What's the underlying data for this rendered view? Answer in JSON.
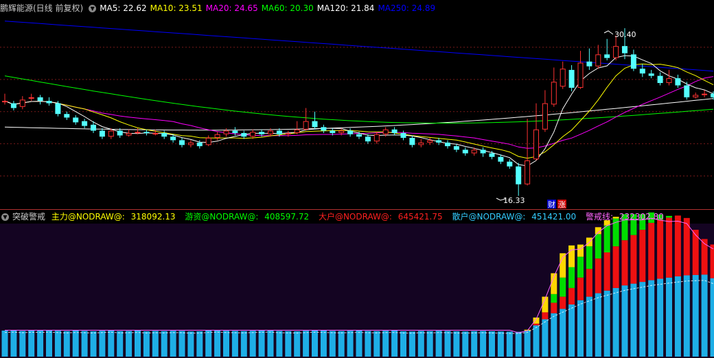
{
  "main_header": {
    "title": "鹏辉能源(日线 前复权)",
    "items": [
      {
        "label": "MA5: 22.62",
        "color": "#ffffff"
      },
      {
        "label": "MA10: 23.51",
        "color": "#ffff00"
      },
      {
        "label": "MA20: 24.65",
        "color": "#ff00ff"
      },
      {
        "label": "MA60: 20.30",
        "color": "#00ff00"
      },
      {
        "label": "MA120: 21.84",
        "color": "#ffffff"
      },
      {
        "label": "MA250: 24.89",
        "color": "#0000ff"
      }
    ]
  },
  "sub_header": {
    "title": "突破警戒",
    "items": [
      {
        "label": "主力@NODRAW@:",
        "value": "318092.13",
        "color": "#ffff00"
      },
      {
        "label": "游资@NODRAW@:",
        "value": "408597.72",
        "color": "#00ff00"
      },
      {
        "label": "大户@NODRAW@:",
        "value": "645421.75",
        "color": "#ff2020"
      },
      {
        "label": "散户@NODRAW@:",
        "value": "451421.00",
        "color": "#33ccff"
      },
      {
        "label": "警戒线:",
        "value": "232302.80",
        "color": "#ff66ff"
      }
    ]
  },
  "annotations": {
    "high_label": "30.40",
    "low_label": "16.33",
    "marker_cai": "财",
    "marker_zhang": "涨"
  },
  "colors": {
    "up": "#ff3232",
    "down": "#54ffff",
    "ma5": "#ffffff",
    "ma10": "#ffff00",
    "ma20": "#ff00ff",
    "ma60": "#00ff00",
    "ma120": "#ffffff",
    "ma250": "#0000ff",
    "zhuli": "#ffd700",
    "youzi": "#00dd00",
    "dahu": "#ee1111",
    "sanhu": "#1eaee6",
    "alert": "#ff66ff",
    "grid": "#7a1a1a",
    "sub_bg": "#140422"
  },
  "chart_data": [
    {
      "type": "candlestick",
      "title": "鹏辉能源(日线 前复权)",
      "price_range": [
        15.5,
        31.5
      ],
      "candles": [
        [
          24.2,
          24.3,
          24.9,
          24.0
        ],
        [
          24.1,
          23.7,
          24.3,
          23.5
        ],
        [
          23.8,
          24.4,
          24.7,
          23.6
        ],
        [
          24.5,
          24.6,
          24.9,
          24.3
        ],
        [
          24.6,
          24.3,
          24.8,
          24.0
        ],
        [
          24.3,
          24.1,
          24.6,
          23.9
        ],
        [
          24.1,
          23.2,
          24.3,
          23.0
        ],
        [
          23.2,
          22.9,
          23.4,
          22.7
        ],
        [
          22.9,
          22.5,
          23.1,
          22.3
        ],
        [
          22.6,
          22.2,
          22.8,
          22.0
        ],
        [
          22.3,
          21.8,
          22.6,
          21.6
        ],
        [
          21.8,
          21.3,
          22.0,
          21.1
        ],
        [
          21.3,
          21.8,
          22.0,
          21.1
        ],
        [
          21.8,
          21.4,
          22.0,
          21.2
        ],
        [
          21.4,
          21.6,
          21.9,
          21.3
        ],
        [
          21.6,
          21.7,
          22.0,
          21.5
        ],
        [
          21.7,
          21.6,
          21.9,
          21.4
        ],
        [
          21.6,
          21.6,
          21.9,
          21.4
        ],
        [
          21.6,
          21.3,
          21.8,
          21.1
        ],
        [
          21.3,
          21.0,
          21.5,
          20.8
        ],
        [
          21.0,
          20.6,
          21.2,
          20.4
        ],
        [
          20.6,
          20.8,
          21.0,
          20.4
        ],
        [
          20.8,
          20.5,
          21.0,
          20.3
        ],
        [
          20.6,
          21.2,
          21.4,
          20.5
        ],
        [
          21.2,
          21.5,
          21.7,
          21.0
        ],
        [
          21.5,
          21.8,
          22.0,
          21.3
        ],
        [
          21.8,
          21.6,
          22.1,
          21.4
        ],
        [
          21.6,
          21.3,
          21.8,
          21.1
        ],
        [
          21.3,
          21.7,
          21.9,
          21.1
        ],
        [
          21.7,
          21.5,
          21.9,
          21.3
        ],
        [
          21.5,
          21.8,
          22.0,
          21.3
        ],
        [
          21.8,
          21.5,
          22.0,
          21.3
        ],
        [
          21.5,
          21.6,
          21.8,
          21.3
        ],
        [
          21.6,
          21.9,
          22.6,
          21.5
        ],
        [
          21.9,
          22.6,
          23.7,
          21.8
        ],
        [
          22.6,
          22.1,
          23.4,
          21.9
        ],
        [
          22.1,
          21.8,
          22.3,
          21.6
        ],
        [
          21.8,
          21.6,
          22.0,
          21.4
        ],
        [
          21.6,
          21.8,
          22.0,
          21.4
        ],
        [
          21.8,
          21.5,
          22.0,
          21.3
        ],
        [
          21.5,
          21.3,
          21.7,
          21.1
        ],
        [
          21.3,
          20.9,
          21.5,
          20.7
        ],
        [
          20.9,
          21.5,
          21.7,
          20.7
        ],
        [
          21.5,
          21.9,
          22.1,
          21.3
        ],
        [
          21.9,
          21.6,
          22.1,
          21.4
        ],
        [
          21.6,
          21.2,
          21.8,
          21.0
        ],
        [
          21.2,
          20.6,
          21.4,
          20.4
        ],
        [
          20.6,
          20.8,
          21.1,
          20.4
        ],
        [
          20.8,
          21.0,
          21.2,
          20.6
        ],
        [
          21.0,
          20.8,
          21.2,
          20.6
        ],
        [
          20.8,
          20.5,
          21.0,
          20.3
        ],
        [
          20.5,
          20.2,
          20.7,
          20.0
        ],
        [
          20.2,
          19.9,
          20.4,
          19.7
        ],
        [
          19.9,
          20.2,
          20.4,
          19.7
        ],
        [
          20.2,
          19.9,
          20.4,
          19.6
        ],
        [
          19.9,
          19.6,
          20.1,
          19.4
        ],
        [
          19.6,
          19.2,
          19.8,
          19.0
        ],
        [
          19.2,
          18.8,
          19.4,
          18.6
        ],
        [
          18.8,
          17.3,
          19.1,
          16.33
        ],
        [
          17.3,
          19.3,
          22.8,
          17.2
        ],
        [
          19.4,
          21.9,
          24.1,
          19.3
        ],
        [
          21.9,
          24.1,
          25.2,
          21.7
        ],
        [
          24.0,
          25.9,
          27.1,
          23.8
        ],
        [
          25.5,
          27.0,
          27.6,
          25.3
        ],
        [
          26.9,
          25.4,
          27.3,
          25.1
        ],
        [
          25.4,
          27.5,
          28.5,
          25.3
        ],
        [
          27.6,
          27.2,
          28.7,
          26.9
        ],
        [
          27.2,
          28.2,
          29.0,
          27.0
        ],
        [
          28.2,
          27.9,
          29.5,
          27.7
        ],
        [
          27.9,
          28.9,
          29.8,
          27.7
        ],
        [
          28.9,
          28.3,
          30.4,
          27.8
        ],
        [
          28.2,
          27.0,
          28.6,
          26.8
        ],
        [
          27.0,
          26.6,
          27.4,
          26.3
        ],
        [
          26.6,
          26.4,
          26.9,
          26.2
        ],
        [
          26.4,
          25.8,
          26.7,
          25.6
        ],
        [
          25.8,
          26.2,
          26.9,
          25.6
        ],
        [
          26.2,
          25.6,
          26.5,
          25.4
        ],
        [
          25.6,
          24.6,
          25.9,
          24.4
        ],
        [
          24.6,
          24.8,
          25.0,
          24.5
        ],
        [
          24.8,
          24.9,
          25.2,
          24.6
        ],
        [
          24.9,
          24.6,
          25.1,
          24.4
        ]
      ],
      "ma120_range": [
        22.1,
        24.5
      ],
      "ma250_range": [
        31.0,
        26.8
      ],
      "ma60_range": [
        26.4,
        23.6
      ]
    },
    {
      "type": "stacked-bar",
      "title": "突破警戒",
      "value_range": [
        0,
        750000
      ],
      "series_names": [
        "散户",
        "大户",
        "游资",
        "主力"
      ],
      "sanhu": [
        150000,
        152000,
        148000,
        151000,
        150000,
        152000,
        149000,
        147000,
        150000,
        148000,
        146000,
        149000,
        151000,
        147000,
        148000,
        150000,
        146000,
        148000,
        147000,
        149000,
        148000,
        145000,
        146000,
        150000,
        152000,
        149000,
        148000,
        147000,
        149000,
        151000,
        152000,
        148000,
        147000,
        146000,
        149000,
        151000,
        150000,
        148000,
        147000,
        149000,
        150000,
        148000,
        147000,
        149000,
        150000,
        146000,
        145000,
        148000,
        147000,
        149000,
        148000,
        146000,
        145000,
        147000,
        148000,
        146000,
        145000,
        144000,
        143000,
        150000,
        180000,
        215000,
        250000,
        275000,
        300000,
        325000,
        345000,
        365000,
        380000,
        395000,
        410000,
        420000,
        430000,
        440000,
        448000,
        455000,
        462000,
        468000,
        470000,
        472000,
        451421
      ],
      "dahu": [
        0,
        0,
        0,
        0,
        0,
        0,
        0,
        0,
        0,
        0,
        0,
        0,
        0,
        0,
        0,
        0,
        0,
        0,
        0,
        0,
        0,
        0,
        0,
        0,
        0,
        0,
        0,
        0,
        0,
        0,
        0,
        0,
        0,
        0,
        0,
        0,
        0,
        0,
        0,
        0,
        0,
        0,
        0,
        0,
        0,
        0,
        0,
        0,
        0,
        0,
        0,
        0,
        0,
        0,
        0,
        0,
        0,
        0,
        0,
        0,
        10000,
        40000,
        60000,
        70000,
        95000,
        130000,
        160000,
        200000,
        220000,
        240000,
        260000,
        280000,
        300000,
        330000,
        340000,
        345000,
        350000,
        330000,
        260000,
        205000,
        194000
      ],
      "youzi": [
        0,
        0,
        0,
        0,
        0,
        0,
        0,
        0,
        0,
        0,
        0,
        0,
        0,
        0,
        0,
        0,
        0,
        0,
        0,
        0,
        0,
        0,
        0,
        0,
        0,
        0,
        0,
        0,
        0,
        0,
        0,
        0,
        0,
        0,
        0,
        0,
        0,
        0,
        0,
        0,
        0,
        0,
        0,
        0,
        0,
        0,
        0,
        0,
        0,
        0,
        0,
        0,
        0,
        0,
        0,
        0,
        0,
        0,
        0,
        0,
        0,
        0,
        50000,
        110000,
        120000,
        120000,
        130000,
        140000,
        155000,
        160000,
        150000,
        120000,
        90000,
        60000,
        30000,
        10000,
        0,
        0,
        0,
        0,
        0
      ],
      "zhuli": [
        0,
        0,
        0,
        0,
        0,
        0,
        0,
        0,
        0,
        0,
        0,
        0,
        0,
        0,
        0,
        0,
        0,
        0,
        0,
        0,
        0,
        0,
        0,
        0,
        0,
        0,
        0,
        0,
        0,
        0,
        0,
        0,
        0,
        0,
        0,
        0,
        0,
        0,
        0,
        0,
        0,
        0,
        0,
        0,
        0,
        0,
        0,
        0,
        0,
        0,
        0,
        0,
        0,
        0,
        0,
        0,
        0,
        0,
        0,
        5000,
        35000,
        90000,
        120000,
        140000,
        125000,
        70000,
        50000,
        40000,
        30000,
        10000,
        0,
        0,
        0,
        0,
        0,
        0,
        0,
        0,
        0,
        0,
        0
      ]
    }
  ]
}
